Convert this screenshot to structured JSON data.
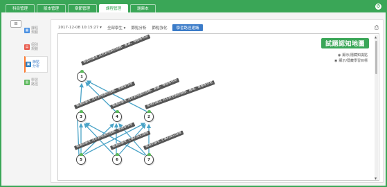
{
  "nav": {
    "tabs": [
      {
        "label": "科目管理",
        "active": false
      },
      {
        "label": "版本管理",
        "active": false
      },
      {
        "label": "章節管理",
        "active": false
      },
      {
        "label": "課程管理",
        "active": true
      },
      {
        "label": "題庫本",
        "active": false
      }
    ],
    "settings_icon": "gear-icon"
  },
  "sidebar": {
    "items": [
      {
        "label": "課程 規劃",
        "icon": "calendar-icon",
        "color": "#4a90e2",
        "active": false
      },
      {
        "label": "個別 規劃",
        "icon": "document-icon",
        "color": "#e8584a",
        "active": false
      },
      {
        "label": "節點 分析",
        "icon": "chart-icon",
        "color": "#2f7fc1",
        "active": true
      },
      {
        "label": "學習 路徑",
        "icon": "path-icon",
        "color": "#5cb85c",
        "active": false
      }
    ]
  },
  "toolbar": {
    "datetime": "2017-12-08 10:15:27 ▾",
    "students": "全部學生 ▾",
    "item1": "節點分析",
    "item2": "節點強化",
    "active_item": "學習路徑建議"
  },
  "map": {
    "title": "試題認知地圖",
    "legend1": "顯示/隱藏知識點",
    "legend2": "顯示/隱藏學習目標",
    "label_long": "能表的變化 流水對地表的侵蝕、搬運、堆積等作用",
    "label_short": "能表的變化 土壤的風化侵蝕",
    "label_mid": "能表的變化 流水對地表的侵蝕、堆積等作用",
    "nodes": [
      "1",
      "2",
      "3",
      "4",
      "5",
      "6",
      "7"
    ]
  },
  "colors": {
    "brand_green": "#3aa657",
    "edge_blue": "#4aa3c7",
    "active_blue": "#3a7bc8"
  }
}
